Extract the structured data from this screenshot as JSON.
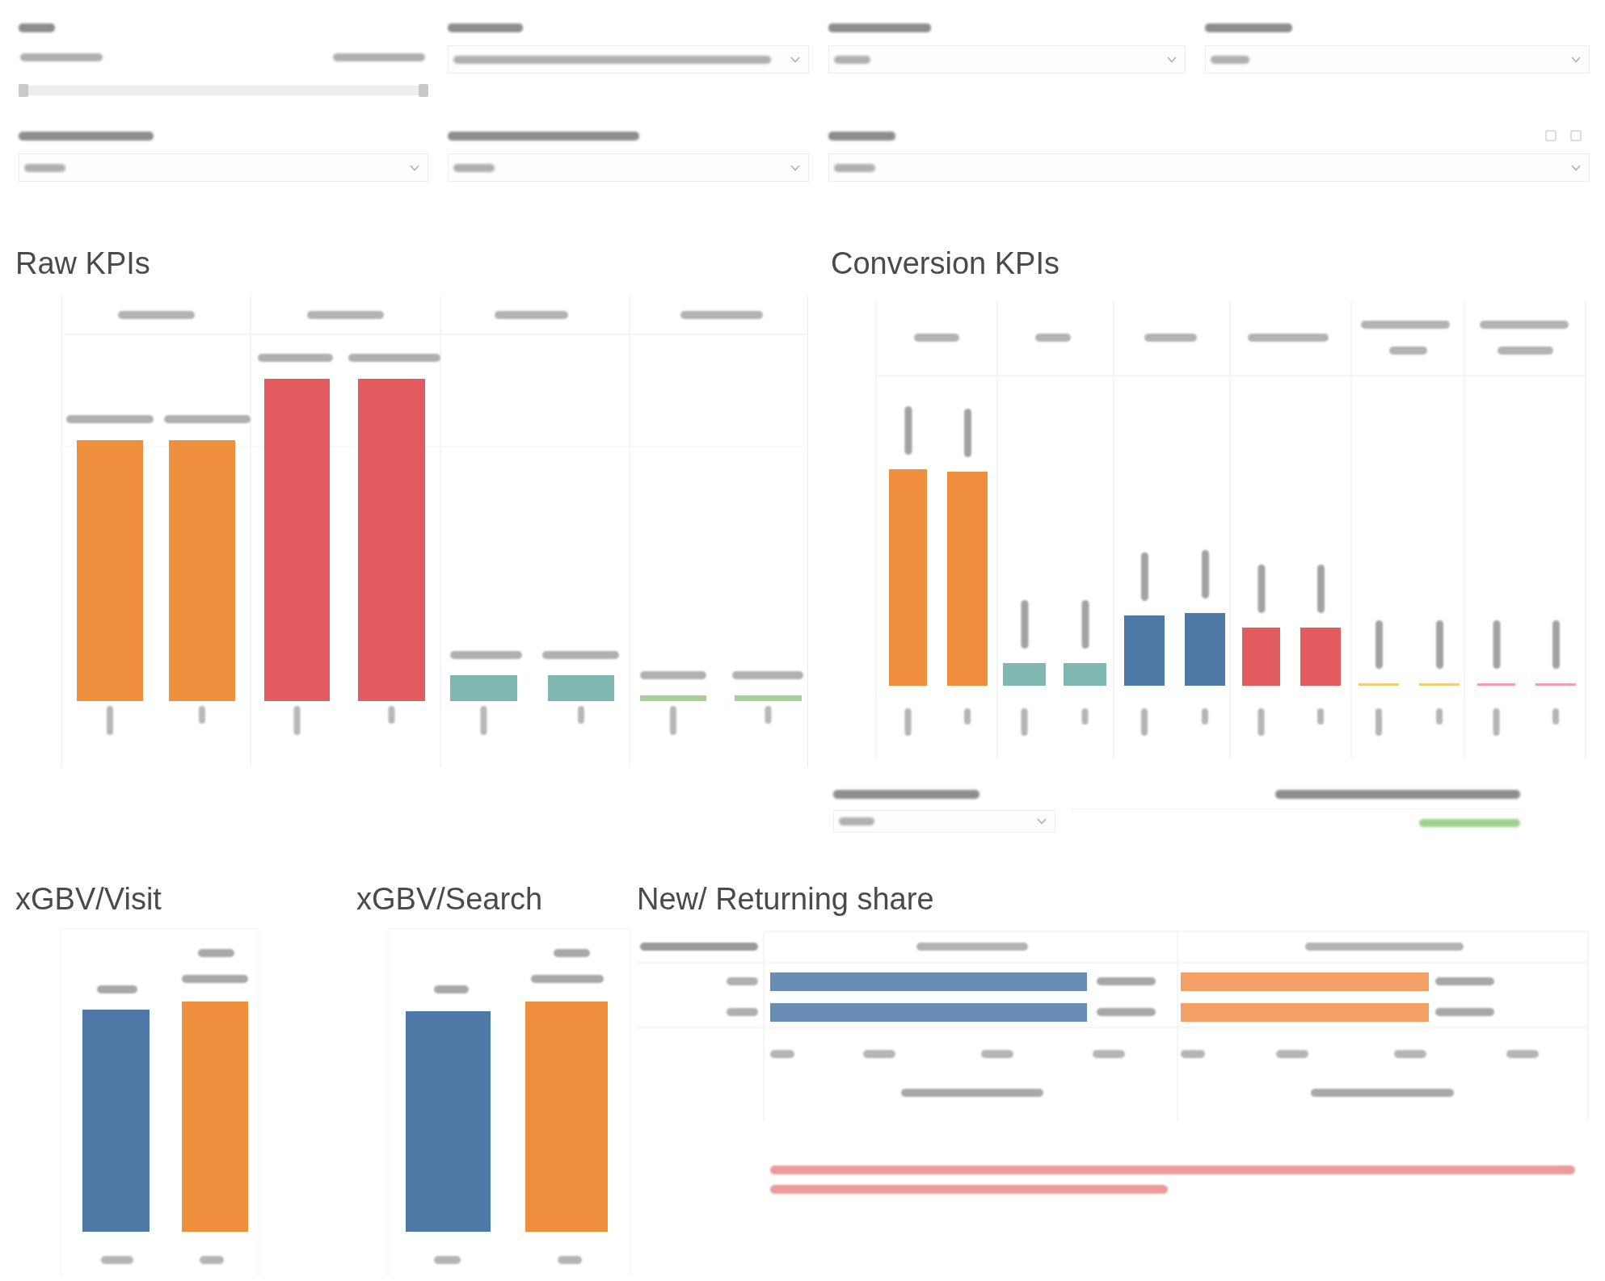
{
  "filter_rows": [
    [
      {
        "kind": "range",
        "level": 1
      },
      {
        "kind": "dropdown"
      },
      {
        "kind": "dropdown"
      },
      {
        "kind": "dropdown"
      }
    ],
    [
      {
        "kind": "dropdown"
      },
      {
        "kind": "dropdown"
      },
      {
        "kind": "dropdown",
        "tools": true
      }
    ]
  ],
  "raw_kpis": {
    "title": "Raw KPIs"
  },
  "conversion_kpis": {
    "title": "Conversion KPIs"
  },
  "xgbv_visit": {
    "title": "xGBV/Visit"
  },
  "xgbv_search": {
    "title": "xGBV/Search"
  },
  "new_returning_share": {
    "title": "New/ Returning share"
  }
}
